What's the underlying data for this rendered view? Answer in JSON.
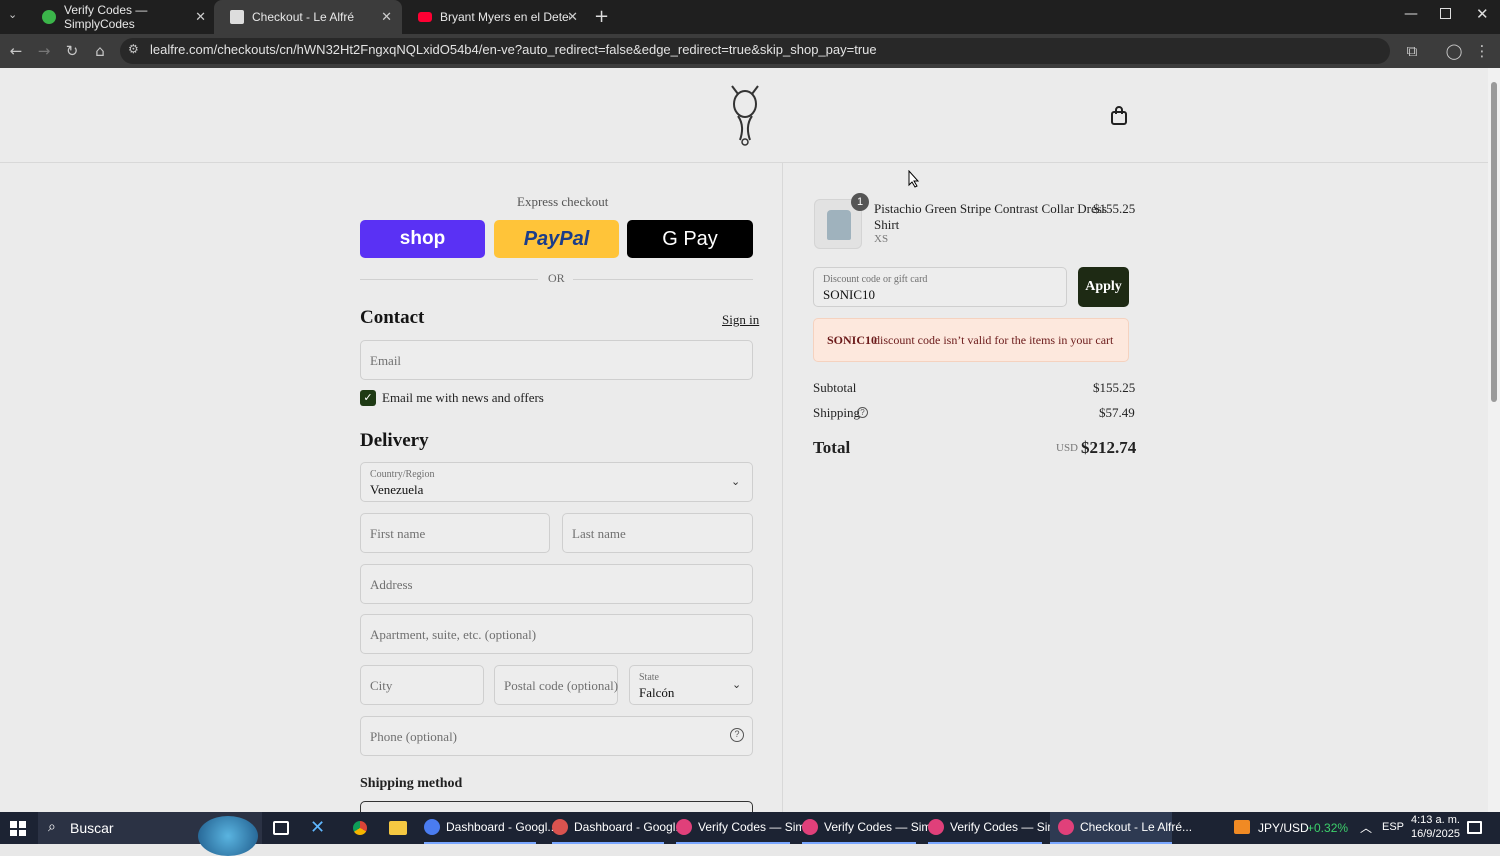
{
  "browser": {
    "tabs": [
      {
        "label": "Verify Codes — SimplyCodes",
        "icon": "simplycodes-icon",
        "color": "#3bb54a"
      },
      {
        "label": "Checkout - Le Alfré",
        "icon": "lealfre-icon",
        "color": "#e8e8e8"
      },
      {
        "label": "Bryant Myers en el Detector de",
        "icon": "youtube-icon",
        "color": "#ff0033"
      }
    ],
    "url": "lealfre.com/checkouts/cn/hWN32Ht2FngxqNQLxidO54b4/en-ve?auto_redirect=false&edge_redirect=true&skip_shop_pay=true"
  },
  "checkout": {
    "express_label": "Express checkout",
    "shop_pay_label": "shop",
    "paypal_label": "PayPal",
    "gpay_label": "G Pay",
    "or_label": "OR",
    "contact_title": "Contact",
    "sign_in": "Sign in",
    "email_placeholder": "Email",
    "newsletter_label": "Email me with news and offers",
    "delivery_title": "Delivery",
    "country_label": "Country/Region",
    "country_value": "Venezuela",
    "first_name": "First name",
    "last_name": "Last name",
    "address": "Address",
    "apartment": "Apartment, suite, etc. (optional)",
    "city": "City",
    "postal": "Postal code (optional)",
    "state_label": "State",
    "state_value": "Falcón",
    "phone": "Phone (optional)",
    "shipping_method_title": "Shipping method"
  },
  "summary": {
    "item_qty": "1",
    "item_name_line1": "Pistachio Green Stripe Contrast Collar Dress",
    "item_name_line2": "Shirt",
    "item_variant": "XS",
    "item_price": "$155.25",
    "discount_label": "Discount code or gift card",
    "discount_value": "SONIC10",
    "apply_label": "Apply",
    "error_code": "SONIC10",
    "error_text": " discount code isn’t valid for the items in your cart",
    "subtotal_label": "Subtotal",
    "subtotal_value": "$155.25",
    "shipping_label": "Shipping",
    "shipping_value": "$57.49",
    "total_label": "Total",
    "total_currency": "USD",
    "total_value": "$212.74"
  },
  "taskbar": {
    "search_label": "Buscar",
    "apps": [
      {
        "label": "Dashboard - Googl...",
        "color": "#4a7cf0"
      },
      {
        "label": "Dashboard - Googl...",
        "color": "#d9534f"
      },
      {
        "label": "Verify Codes — Sim...",
        "color": "#e0407a"
      },
      {
        "label": "Verify Codes — Sim...",
        "color": "#e0407a"
      },
      {
        "label": "Verify Codes — Sim...",
        "color": "#e0407a"
      },
      {
        "label": "Checkout - Le Alfré...",
        "color": "#e0407a"
      }
    ],
    "stock_label": "JPY/USD",
    "stock_change": "+0.32%",
    "lang": "ESP",
    "time": "4:13 a. m.",
    "date": "16/9/2025"
  }
}
